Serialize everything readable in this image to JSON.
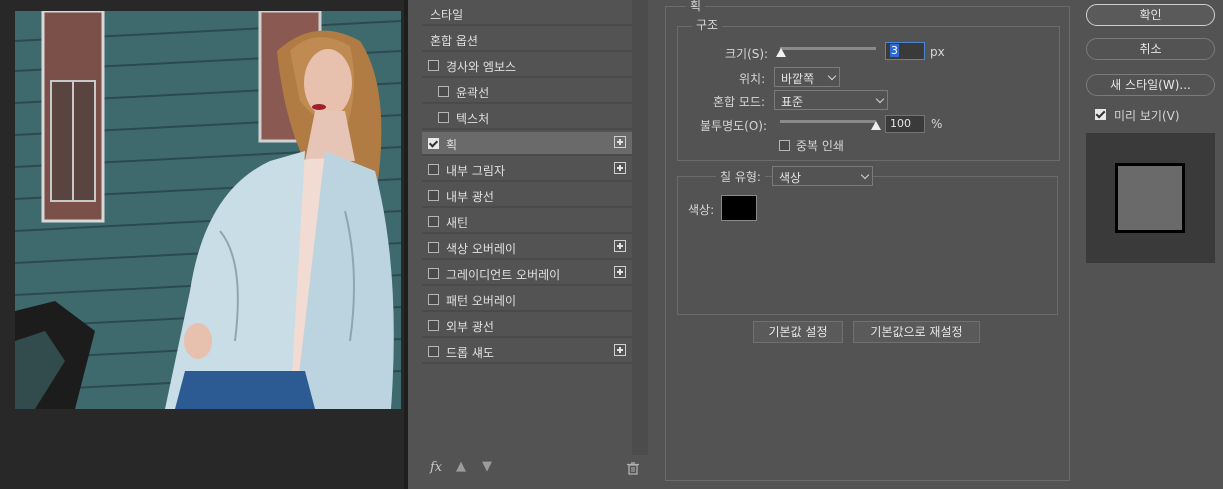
{
  "style_list": [
    {
      "label": "스타일",
      "checkbox": false,
      "checked": false,
      "plus": false,
      "indent": 0,
      "active": false
    },
    {
      "label": "혼합 옵션",
      "checkbox": false,
      "checked": false,
      "plus": false,
      "indent": 0,
      "active": false
    },
    {
      "label": "경사와 엠보스",
      "checkbox": true,
      "checked": false,
      "plus": false,
      "indent": 0,
      "active": false
    },
    {
      "label": "윤곽선",
      "checkbox": true,
      "checked": false,
      "plus": false,
      "indent": 1,
      "active": false
    },
    {
      "label": "텍스처",
      "checkbox": true,
      "checked": false,
      "plus": false,
      "indent": 1,
      "active": false
    },
    {
      "label": "획",
      "checkbox": true,
      "checked": true,
      "plus": true,
      "indent": 0,
      "active": true
    },
    {
      "label": "내부 그림자",
      "checkbox": true,
      "checked": false,
      "plus": true,
      "indent": 0,
      "active": false
    },
    {
      "label": "내부 광선",
      "checkbox": true,
      "checked": false,
      "plus": false,
      "indent": 0,
      "active": false
    },
    {
      "label": "새틴",
      "checkbox": true,
      "checked": false,
      "plus": false,
      "indent": 0,
      "active": false
    },
    {
      "label": "색상 오버레이",
      "checkbox": true,
      "checked": false,
      "plus": true,
      "indent": 0,
      "active": false
    },
    {
      "label": "그레이디언트 오버레이",
      "checkbox": true,
      "checked": false,
      "plus": true,
      "indent": 0,
      "active": false
    },
    {
      "label": "패턴 오버레이",
      "checkbox": true,
      "checked": false,
      "plus": false,
      "indent": 0,
      "active": false
    },
    {
      "label": "외부 광선",
      "checkbox": true,
      "checked": false,
      "plus": false,
      "indent": 0,
      "active": false
    },
    {
      "label": "드롭 섀도",
      "checkbox": true,
      "checked": false,
      "plus": true,
      "indent": 0,
      "active": false
    }
  ],
  "list_tools": {
    "fx": "fx",
    "up_icon": "arrow-up-icon",
    "down_icon": "arrow-down-icon",
    "trash_icon": "trash-icon"
  },
  "panel": {
    "title": "획",
    "structure": {
      "legend": "구조",
      "size_label": "크기(S):",
      "size_value": "3",
      "size_unit": "px",
      "position_label": "위치:",
      "position_value": "바깥쪽",
      "blend_label": "혼합 모드:",
      "blend_value": "표준",
      "opacity_label": "불투명도(O):",
      "opacity_value": "100",
      "opacity_unit": "%",
      "overprint_label": "중복 인쇄"
    },
    "fill": {
      "fill_type_label": "칠 유형:",
      "fill_type_value": "색상",
      "color_label": "색상:",
      "color_value": "#000000"
    },
    "defaults_button": "기본값 설정",
    "reset_button": "기본값으로 재설정"
  },
  "buttons": {
    "ok": "확인",
    "cancel": "취소",
    "new_style": "새 스타일(W)...",
    "preview_label": "미리 보기(V)"
  },
  "colors": {
    "panel_bg": "#535353",
    "canvas_bg": "#282828",
    "preview_swatch": "#6a6a6a"
  }
}
